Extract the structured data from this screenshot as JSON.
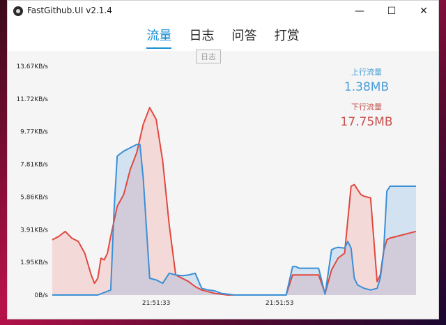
{
  "window": {
    "title": "FastGithub.UI v2.1.4",
    "controls": {
      "minimize": "—",
      "maximize": "☐",
      "close": "✕"
    }
  },
  "tabs": [
    {
      "label": "流量",
      "active": true
    },
    {
      "label": "日志",
      "active": false
    },
    {
      "label": "问答",
      "active": false
    },
    {
      "label": "打赏",
      "active": false
    }
  ],
  "tooltip": "日志",
  "stats": {
    "upload_label": "上行流量",
    "upload_value": "1.38MB",
    "download_label": "下行流量",
    "download_value": "17.75MB"
  },
  "colors": {
    "upload": "#3a8fd6",
    "download": "#e0483e"
  },
  "chart_data": {
    "type": "area",
    "y_ticks": [
      "0B/s",
      "1.95KB/s",
      "3.91KB/s",
      "5.86KB/s",
      "7.81KB/s",
      "9.77KB/s",
      "11.72KB/s",
      "13.67KB/s"
    ],
    "ylim": [
      0,
      13.67
    ],
    "x_ticks": [
      {
        "label": "21:51:33",
        "t": 32
      },
      {
        "label": "21:51:53",
        "t": 70
      }
    ],
    "xlim": [
      0,
      112
    ],
    "series": [
      {
        "name": "上行流量",
        "t": [
          0,
          10,
          14,
          18,
          19,
          20,
          22,
          24,
          26,
          27,
          28,
          30,
          32,
          34,
          36,
          38,
          40,
          42,
          44,
          46,
          48,
          50,
          52,
          54,
          56,
          58,
          60,
          62,
          64,
          72,
          74,
          75,
          76,
          78,
          82,
          84,
          86,
          87,
          88,
          90,
          91,
          92,
          93,
          94,
          95,
          96,
          98,
          100,
          101,
          102,
          103,
          104,
          106,
          108,
          110,
          111,
          112
        ],
        "values": [
          0,
          0,
          0,
          0.3,
          5,
          8.3,
          8.6,
          8.8,
          9.0,
          9.0,
          7,
          1,
          0.9,
          0.7,
          1.3,
          1.2,
          1.15,
          1.2,
          1.3,
          0.4,
          0.3,
          0.25,
          0.1,
          0.05,
          0,
          0,
          0,
          0,
          0,
          0,
          1.7,
          1.7,
          1.6,
          1.6,
          1.6,
          0.05,
          2.7,
          2.8,
          2.85,
          2.8,
          3.2,
          2.8,
          1.0,
          0.6,
          0.5,
          0.4,
          0.3,
          0.4,
          1.0,
          2.5,
          6.2,
          6.5,
          6.5,
          6.5,
          6.5,
          6.5,
          6.5
        ]
      },
      {
        "name": "下行流量",
        "t": [
          0,
          2,
          4,
          6,
          8,
          10,
          12,
          13,
          14,
          15,
          16,
          17,
          18,
          20,
          22,
          24,
          26,
          28,
          30,
          32,
          34,
          36,
          38,
          40,
          42,
          44,
          46,
          48,
          50,
          52,
          54,
          56,
          58,
          60,
          62,
          64,
          72,
          74,
          76,
          78,
          80,
          82,
          84,
          86,
          88,
          90,
          92,
          93,
          94,
          95,
          96,
          98,
          100,
          101,
          102,
          103,
          104,
          106,
          108,
          110,
          112
        ],
        "values": [
          3.3,
          3.5,
          3.8,
          3.4,
          3.2,
          2.5,
          1.2,
          0.7,
          1.0,
          2.2,
          2.1,
          2.5,
          3.5,
          5.3,
          6.0,
          7.5,
          8.5,
          10.2,
          11.2,
          10.5,
          8.0,
          4.2,
          1.2,
          1.0,
          0.8,
          0.5,
          0.3,
          0.2,
          0.1,
          0.05,
          0,
          0,
          0,
          0,
          0,
          0,
          0,
          1.2,
          1.2,
          1.2,
          1.2,
          1.2,
          0.1,
          1.5,
          2.2,
          2.5,
          6.5,
          6.6,
          6.3,
          6.0,
          5.9,
          5.8,
          0.8,
          1.2,
          2.6,
          3.3,
          3.4,
          3.5,
          3.6,
          3.7,
          3.8
        ]
      }
    ],
    "grid": false,
    "legend": "none"
  }
}
